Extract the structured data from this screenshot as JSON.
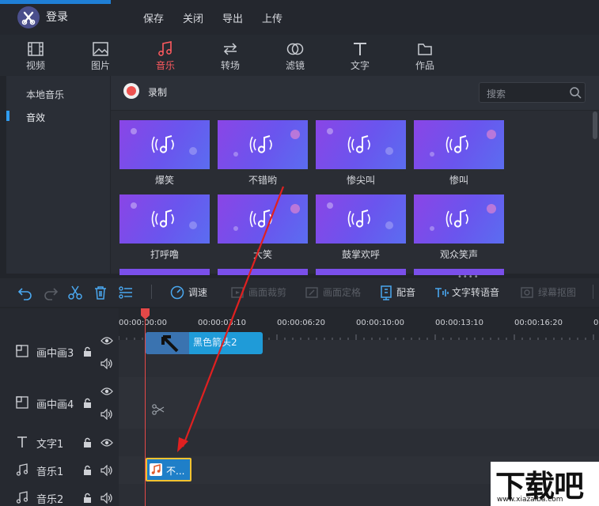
{
  "titlebar": {
    "login_label": "登录",
    "menu": [
      "保存",
      "关闭",
      "导出",
      "上传"
    ]
  },
  "media_tabs": [
    {
      "label": "视频",
      "icon": "film-icon",
      "active": false
    },
    {
      "label": "图片",
      "icon": "image-icon",
      "active": false
    },
    {
      "label": "音乐",
      "icon": "music-note-icon",
      "active": true
    },
    {
      "label": "转场",
      "icon": "transition-arrows-icon",
      "active": false
    },
    {
      "label": "滤镜",
      "icon": "filter-circles-icon",
      "active": false
    },
    {
      "label": "文字",
      "icon": "text-T-icon",
      "active": false
    },
    {
      "label": "作品",
      "icon": "folder-icon",
      "active": false
    }
  ],
  "colors": {
    "accent": "#ff5a5f",
    "active_marker": "#2f9cf0",
    "clip_blue": "#1f9bd8",
    "playhead": "#e54848"
  },
  "library": {
    "sidebar": [
      "本地音乐",
      "音效"
    ],
    "record_label": "录制",
    "search_placeholder": "搜索",
    "items": [
      "爆笑",
      "不错哟",
      "惨尖叫",
      "惨叫",
      "打呼噜",
      "大笑",
      "鼓掌欢呼",
      "观众笑声"
    ]
  },
  "toolbar": {
    "speed_label": "调速",
    "crop_label": "画面裁剪",
    "freeze_label": "画面定格",
    "dub_label": "配音",
    "tts_label": "文字转语音",
    "greenscreen_label": "绿幕抠图"
  },
  "timeline": {
    "ticks": [
      "00:00:00:00",
      "00:00:03:10",
      "00:00:06:20",
      "00:00:10:00",
      "00:00:13:10",
      "00:00:16:20"
    ],
    "tracks": [
      "画中画3",
      "画中画4",
      "文字1",
      "音乐1",
      "音乐2"
    ],
    "pip_clip_label": "黑色箭头2",
    "music_clip_label": "不..."
  },
  "watermark": {
    "text": "下载吧",
    "url": "www.xiazaiba.com"
  }
}
